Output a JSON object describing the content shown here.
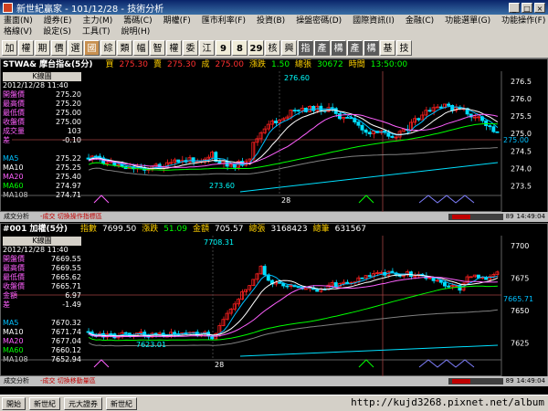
{
  "window": {
    "title": "新世紀贏家 - 101/12/28 - 技術分析"
  },
  "menu": {
    "row1": [
      "畫面(N)",
      "證券(E)",
      "主力(M)",
      "籌碼(C)",
      "期權(F)",
      "匯市利率(F)",
      "投資(B)",
      "操盤密碼(D)",
      "國際資訊(I)",
      "金融(C)",
      "功能選單(G)",
      "功能操作(F)"
    ],
    "row2": [
      "格線(V)",
      "設定(S)",
      "工具(T)",
      "說明(H)"
    ]
  },
  "toolbar": [
    "加",
    "權",
    "期",
    "價",
    "選",
    "國",
    "綜",
    "類",
    "幅",
    "智",
    "權",
    "委",
    "江",
    "9",
    "8",
    "29",
    "核",
    "興",
    "指",
    "產",
    "構",
    "產",
    "構",
    "基",
    "技"
  ],
  "panel1": {
    "name": "STWA& 摩台指&(5分)",
    "buy_lbl": "買",
    "buy": "275.30",
    "sell_lbl": "賣",
    "sell": "275.30",
    "deal_lbl": "成",
    "deal": "275.00",
    "chg_lbl": "漲跌",
    "chg": "1.50",
    "vol_lbl": "總張",
    "vol": "30672",
    "time_lbl": "時間",
    "time": "13:50:00",
    "info": {
      "title": "K線圖",
      "date": "2012/12/28 11:40",
      "rows": [
        [
          "開盤價",
          "275.20"
        ],
        [
          "最高價",
          "275.20"
        ],
        [
          "最低價",
          "275.00"
        ],
        [
          "收盤價",
          "275.00"
        ],
        [
          "成交量",
          "103"
        ],
        [
          "差",
          "-0.10"
        ]
      ],
      "ma": [
        [
          "MA5",
          "275.22"
        ],
        [
          "MA10",
          "275.25"
        ],
        [
          "MA20",
          "275.40"
        ],
        [
          "MA60",
          "274.97"
        ],
        [
          "MA108",
          "274.71"
        ]
      ]
    },
    "annotations": {
      "high": "276.60",
      "low": "273.60",
      "date": "28",
      "last": "275.00"
    },
    "axis": [
      "276.5",
      "276.0",
      "275.5",
      "275.0",
      "274.5",
      "274.0",
      "273.5"
    ]
  },
  "panel2": {
    "name": "#001 加權(5分)",
    "idx_lbl": "指數",
    "idx": "7699.50",
    "chg_lbl": "漲跌",
    "chg": "51.09",
    "amt_lbl": "金額",
    "amt": "705.57",
    "vol_lbl": "總張",
    "vol": "3168423",
    "cnt_lbl": "總筆",
    "cnt": "631567",
    "info": {
      "title": "K線圖",
      "date": "2012/12/28 11:40",
      "rows": [
        [
          "開盤價",
          "7669.55"
        ],
        [
          "最高價",
          "7669.55"
        ],
        [
          "最低價",
          "7665.62"
        ],
        [
          "收盤價",
          "7665.71"
        ],
        [
          "金額",
          "6.97"
        ],
        [
          "差",
          "-1.49"
        ]
      ],
      "ma": [
        [
          "MA5",
          "7670.32"
        ],
        [
          "MA10",
          "7671.74"
        ],
        [
          "MA20",
          "7677.04"
        ],
        [
          "MA60",
          "7660.12"
        ],
        [
          "MA108",
          "7652.94"
        ]
      ]
    },
    "annotations": {
      "high": "7708.31",
      "low": "7623.01",
      "date": "28",
      "last": "7665.71"
    },
    "axis": [
      "7700",
      "7675",
      "7650",
      "7625"
    ]
  },
  "strip1": {
    "left": "成交分析",
    "mid": "-成交 切換操作指標區",
    "zoom": "89",
    "time": "14:49:04"
  },
  "strip2": {
    "left": "成交分析",
    "mid": "-成交 切換移動量區",
    "zoom": "89",
    "time": "14:49:04"
  },
  "taskbar": [
    "開始",
    "新世紀",
    "元大證券",
    "新世紀"
  ],
  "watermark": "http://kujd3268.pixnet.net/album",
  "colors": {
    "candle_up": "#ff2020",
    "candle_down": "#00e0ff",
    "ma5": "#00c0ff",
    "ma10": "#ffffff",
    "ma20": "#ff60ff",
    "ma60": "#00ff00",
    "ma108": "#808080"
  }
}
